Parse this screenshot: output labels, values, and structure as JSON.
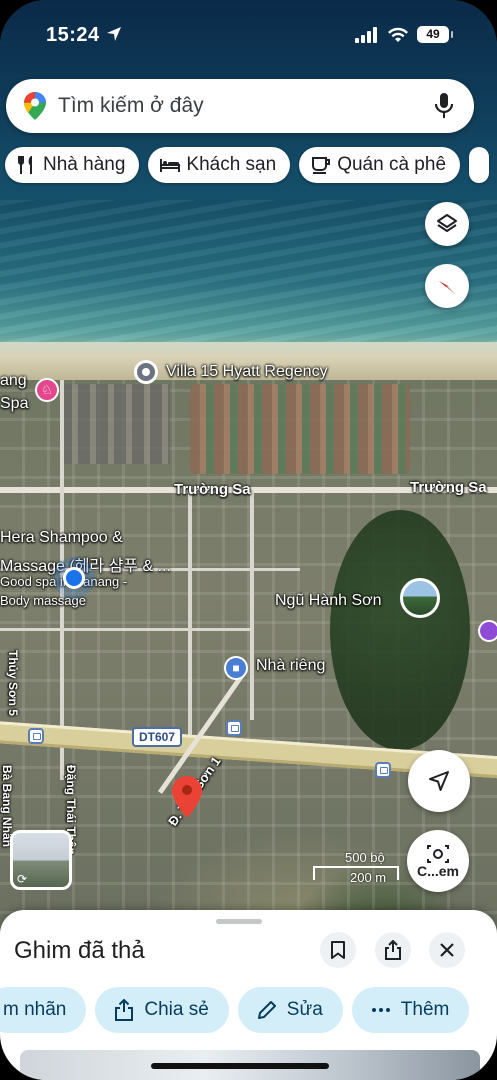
{
  "status_bar": {
    "time": "15:24",
    "battery": "49"
  },
  "search": {
    "placeholder": "Tìm kiếm ở đây"
  },
  "chips": [
    {
      "label": "Nhà hàng",
      "icon": "restaurant-icon"
    },
    {
      "label": "Khách sạn",
      "icon": "hotel-icon"
    },
    {
      "label": "Quán cà phê",
      "icon": "coffee-icon"
    }
  ],
  "map": {
    "labels": {
      "villa": "Villa 15 Hyatt Regency",
      "spa_partial_1": "ang",
      "spa_partial_2": "Spa",
      "truong_sa_1": "Trường Sa",
      "truong_sa_2": "Trường Sa",
      "hera_1": "Hera Shampoo &",
      "hera_2": "Massage (헤라 샴푸 & ...",
      "hera_3": "Good spa in Danang -",
      "hera_4": "Body massage",
      "ngu_hanh_son": "Ngũ Hành Sơn",
      "nha_rieng": "Nhà riêng",
      "route": "DT607",
      "tho_son": "Đ. Thổ Sơn 1",
      "dang_thai": "Đặng Thái Thân",
      "ba_bang": "Bà Bang Nhãn",
      "thuy_son": "Thủy Sơn 5"
    },
    "scale": {
      "upper": "500 bộ",
      "lower": "200 m"
    }
  },
  "buttons": {
    "lens_label": "C...em"
  },
  "sheet": {
    "title": "Ghim đã thả",
    "actions": [
      {
        "label": "m nhãn",
        "icon": "label-icon"
      },
      {
        "label": "Chia sẻ",
        "icon": "share-icon"
      },
      {
        "label": "Sửa",
        "icon": "pencil-icon"
      },
      {
        "label": "Thêm",
        "icon": "more-icon"
      }
    ]
  },
  "colors": {
    "accent_blue": "#1a73e8",
    "pin_red": "#ea4335",
    "action_bg": "#d3eef8"
  }
}
